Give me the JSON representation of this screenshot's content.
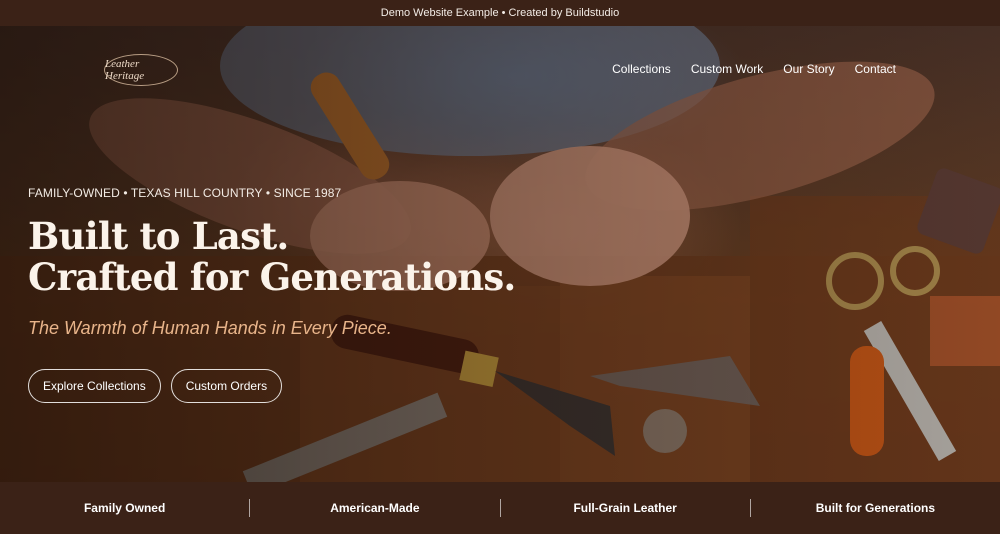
{
  "banner": {
    "text": "Demo Website Example • Created by Buildstudio"
  },
  "brand": {
    "logo_text": "Leather Heritage"
  },
  "nav": {
    "items": [
      {
        "label": "Collections"
      },
      {
        "label": "Custom Work"
      },
      {
        "label": "Our Story"
      },
      {
        "label": "Contact"
      }
    ]
  },
  "hero": {
    "eyebrow": "FAMILY-OWNED • TEXAS HILL COUNTRY • SINCE 1987",
    "headline_line1": "Built to Last.",
    "headline_line2": "Crafted for Generations.",
    "tagline": "The Warmth of Human Hands in Every Piece.",
    "primary_cta": "Explore Collections",
    "secondary_cta": "Custom Orders"
  },
  "features": [
    {
      "label": "Family Owned"
    },
    {
      "label": "American-Made"
    },
    {
      "label": "Full-Grain Leather"
    },
    {
      "label": "Built for Generations"
    }
  ],
  "colors": {
    "bar_background": "#3b2217",
    "tagline_accent": "#e8b48a",
    "headline_text": "#fbf3ea"
  }
}
